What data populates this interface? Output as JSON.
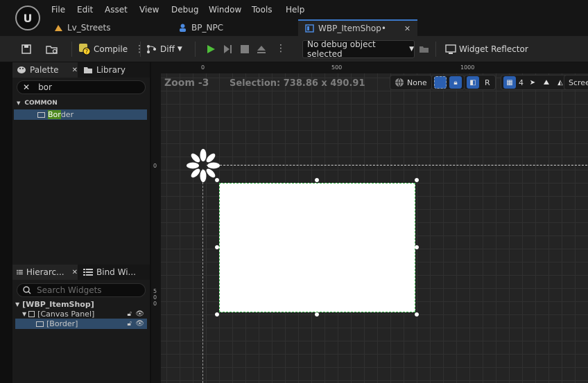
{
  "menu": [
    "File",
    "Edit",
    "Asset",
    "View",
    "Debug",
    "Window",
    "Tools",
    "Help"
  ],
  "tabs": [
    {
      "label": "Lv_Streets"
    },
    {
      "label": "BP_NPC"
    },
    {
      "label": "WBP_ItemShop•"
    }
  ],
  "toolbar": {
    "compile_label": "Compile",
    "diff_label": "Diff",
    "debug_object": "No debug object selected",
    "widget_reflector_label": "Widget Reflector"
  },
  "palette": {
    "tab_label": "Palette",
    "library_label": "Library",
    "search_value": "bor",
    "section": "COMMON",
    "item_match": "Bor",
    "item_rest": "der"
  },
  "hierarchy": {
    "tab_label": "Hierarc...",
    "bind_label": "Bind Wi...",
    "search_placeholder": "Search Widgets",
    "root": "[WBP_ItemShop]",
    "canvas_panel": "[Canvas Panel]",
    "border": "[Border]"
  },
  "designer": {
    "zoom": "Zoom -3",
    "selection": "Selection: 738.86 x 490.91",
    "dpi_label": "None",
    "r_label": "R",
    "grid_size": "4",
    "screen_label": "Screen",
    "ruler_top": [
      "0",
      "500",
      "1000"
    ],
    "ruler_left_0": "0",
    "ruler_left_500": [
      "5",
      "0",
      "0"
    ]
  },
  "colors": {
    "accent_blue": "#3b78c9",
    "selected_row": "#2f4b69",
    "search_highlight": "#4e8a1e",
    "selection_outline": "#39b54a"
  }
}
